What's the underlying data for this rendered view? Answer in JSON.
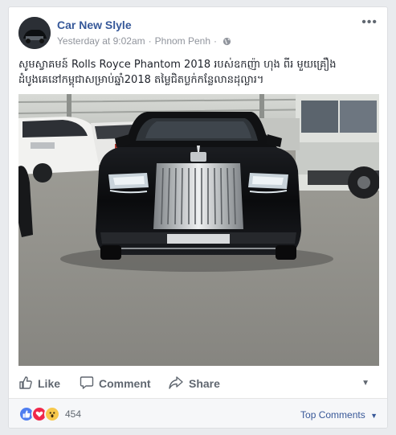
{
  "post": {
    "page_name": "Car New Slyle",
    "timestamp": "Yesterday at 9:02am",
    "location": "Phnom Penh",
    "more_icon": "ellipsis-icon",
    "caption_line1": "សូមស្វាគមន៍ Rolls Royce Phantom 2018 របស់ឧកញ៉ា ហុង ពីរ មួយគ្រឿង",
    "caption_line2": "ដំបូងគេនៅកម្ពុជាសម្រាប់ឆ្នាំ2018 តម្លៃជិតប្លក់កន្លែលានដុល្លារ។",
    "photo_subject": "black Rolls Royce Phantom front view in garage"
  },
  "actions": {
    "like": "Like",
    "comment": "Comment",
    "share": "Share"
  },
  "reactions": {
    "count": "454",
    "types": [
      "like",
      "love",
      "wow"
    ]
  },
  "comments_filter": "Top Comments",
  "colors": {
    "link": "#365899",
    "muted": "#90949c",
    "action": "#606770",
    "footer_bg": "#f6f7f9"
  }
}
